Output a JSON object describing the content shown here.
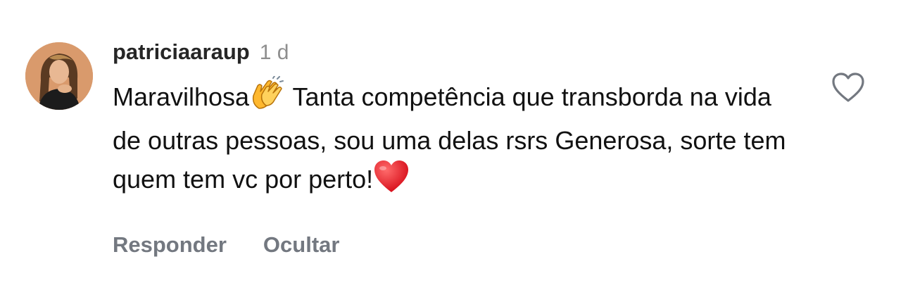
{
  "comment": {
    "username": "patriciaaraup",
    "time": "1 d",
    "text_part1": "Maravilhosa",
    "text_part2": " Tanta competência que transborda na vida de outras pessoas, sou uma delas rsrs Generosa, sorte tem quem tem vc por perto!",
    "emoji_clap": "clapping-hands-icon",
    "emoji_heart": "red-heart-icon"
  },
  "actions": {
    "reply_label": "Responder",
    "hide_label": "Ocultar"
  },
  "like_icon": "heart-outline-icon",
  "colors": {
    "username": "#262626",
    "secondary": "#8e8e8e",
    "action": "#737880",
    "heart_emoji": "#e0202a"
  }
}
